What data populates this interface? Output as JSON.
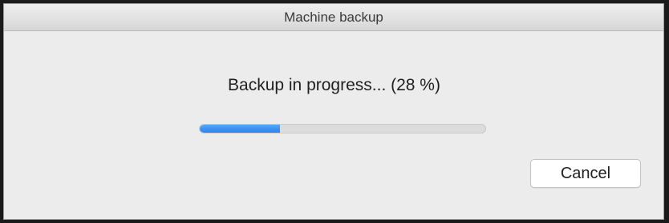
{
  "window": {
    "title": "Machine backup"
  },
  "status": {
    "message": "Backup in progress... (28 %)"
  },
  "progress": {
    "percent": 28
  },
  "buttons": {
    "cancel_label": "Cancel"
  }
}
